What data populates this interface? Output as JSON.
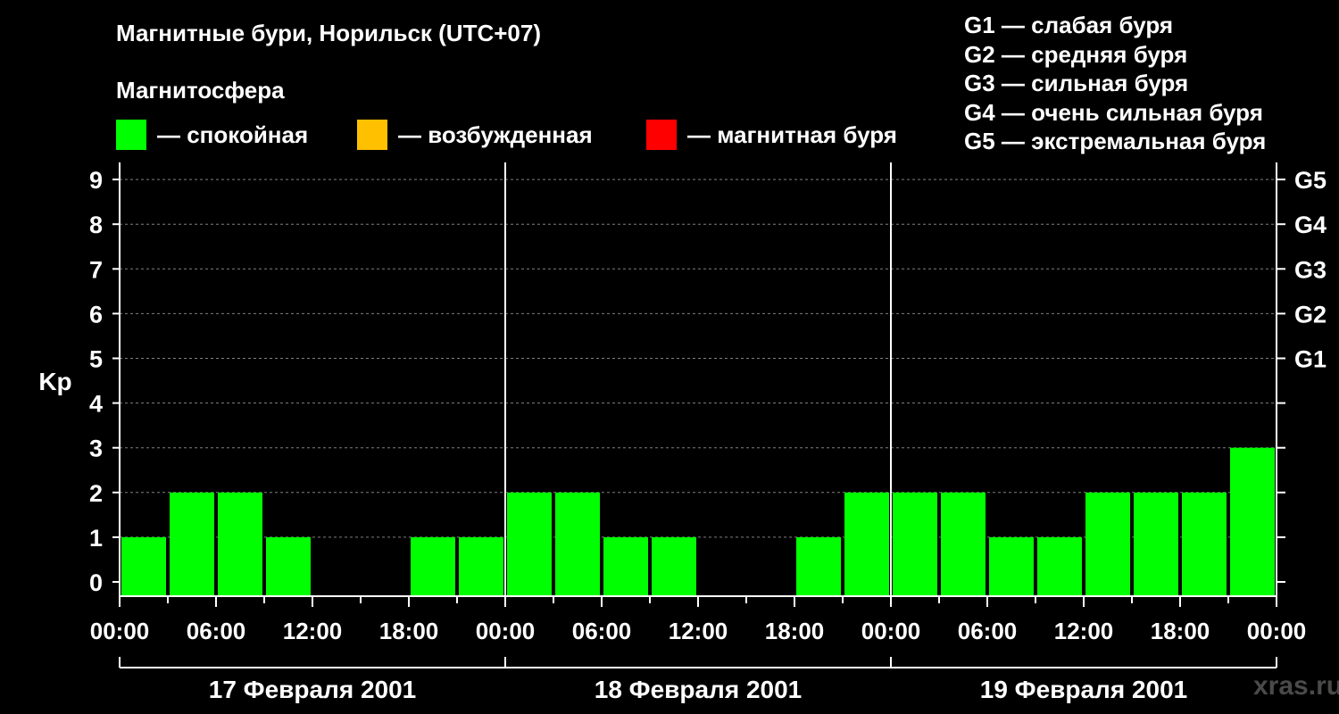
{
  "chart_data": {
    "type": "bar",
    "title": "Магнитные бури, Норильск (UTC+07)",
    "subtitle": "Магнитосфера",
    "legend": [
      {
        "label": "— спокойная",
        "color": "#00ff00"
      },
      {
        "label": "— возбужденная",
        "color": "#ffc000"
      },
      {
        "label": "— магнитная буря",
        "color": "#ff0000"
      }
    ],
    "storm_levels": [
      "G1 — слабая буря",
      "G2 — средняя буря",
      "G3 — сильная буря",
      "G4 — очень сильная буря",
      "G5 — экстремальная буря"
    ],
    "ylabel": "Kp",
    "ylim": [
      0,
      9
    ],
    "yticks": [
      "0",
      "1",
      "2",
      "3",
      "4",
      "5",
      "6",
      "7",
      "8",
      "9"
    ],
    "g_ticks": [
      {
        "kp": 5,
        "label": "G1"
      },
      {
        "kp": 6,
        "label": "G2"
      },
      {
        "kp": 7,
        "label": "G3"
      },
      {
        "kp": 8,
        "label": "G4"
      },
      {
        "kp": 9,
        "label": "G5"
      }
    ],
    "x_tick_labels": [
      "00:00",
      "06:00",
      "12:00",
      "18:00",
      "00:00",
      "06:00",
      "12:00",
      "18:00",
      "00:00",
      "06:00",
      "12:00",
      "18:00",
      "00:00"
    ],
    "days": [
      "17 Февраля 2001",
      "18 Февраля 2001",
      "19 Февраля 2001"
    ],
    "interval_hours": 3,
    "values": [
      1,
      2,
      2,
      1,
      0,
      0,
      1,
      1,
      2,
      2,
      1,
      1,
      0,
      0,
      1,
      2,
      2,
      2,
      1,
      1,
      2,
      2,
      2,
      3
    ],
    "grid": true,
    "watermark": "xras.ru"
  }
}
